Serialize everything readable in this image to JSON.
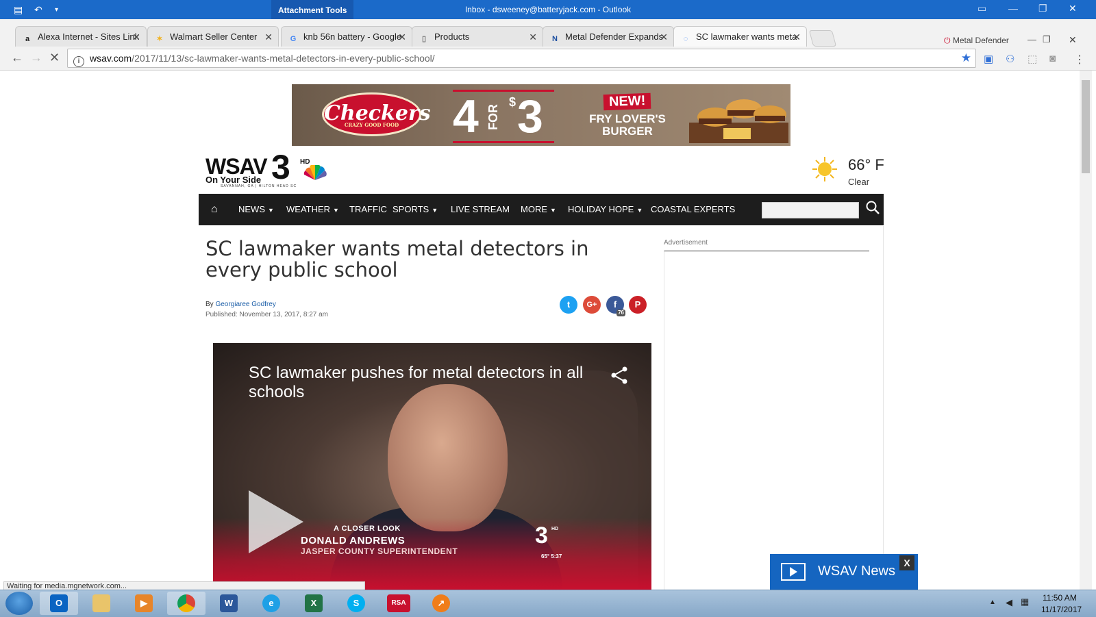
{
  "outlook": {
    "contextual_tab": "Attachment Tools",
    "window_title": "Inbox - dsweeney@batteryjack.com - Outlook"
  },
  "browser": {
    "tabs": [
      {
        "label": "Alexa Internet - Sites Link",
        "icon": "alexa-icon",
        "color": "#222222"
      },
      {
        "label": "Walmart Seller Center",
        "icon": "walmart-spark-icon",
        "color": "#f2b21e"
      },
      {
        "label": "knb 56n battery - Google",
        "icon": "google-icon",
        "color": "#4285f4"
      },
      {
        "label": "Products",
        "icon": "page-icon",
        "color": "#777777"
      },
      {
        "label": "Metal Defender Expands",
        "icon": "n-icon",
        "color": "#1d4fa0"
      },
      {
        "label": "SC lawmaker wants meta",
        "icon": "loading-icon",
        "color": "#4285f4"
      }
    ],
    "extension_badge": "Metal Defender",
    "url_host": "wsav.com",
    "url_path": "/2017/11/13/sc-lawmaker-wants-metal-detectors-in-every-public-school/",
    "status_text": "Waiting for media.mgnetwork.com..."
  },
  "ad": {
    "brand": "Checkers",
    "brand_tagline": "CRAZY GOOD FOOD",
    "deal_main": "4",
    "deal_for": "FOR",
    "deal_price_symbol": "$",
    "deal_price": "3",
    "new_badge": "NEW!",
    "product": "FRY LOVER'S BURGER"
  },
  "site": {
    "logo_text": "WSAV",
    "logo_number": "3",
    "logo_hd": "HD",
    "tagline": "On Your Side",
    "sub_tagline": "SAVANNAH, GA | HILTON HEAD SC",
    "temperature": "66° F",
    "condition": "Clear",
    "nav": [
      {
        "label": "NEWS",
        "caret": true
      },
      {
        "label": "WEATHER",
        "caret": true
      },
      {
        "label": "TRAFFIC",
        "caret": false
      },
      {
        "label": "SPORTS",
        "caret": true
      },
      {
        "label": "LIVE STREAM",
        "caret": false
      },
      {
        "label": "MORE",
        "caret": true
      },
      {
        "label": "HOLIDAY HOPE",
        "caret": true
      },
      {
        "label": "COASTAL EXPERTS",
        "caret": false
      }
    ]
  },
  "article": {
    "headline": "SC lawmaker wants metal detectors in every public school",
    "by": "By",
    "author": "Georgiaree Godfrey",
    "published": "Published: November 13, 2017, 8:27 am",
    "facebook_count": "76",
    "advertisement_label": "Advertisement"
  },
  "video": {
    "title": "SC lawmaker pushes for metal detectors in all schools",
    "segment": "A CLOSER LOOK",
    "name": "DONALD ANDREWS",
    "role": "JASPER COUNTY SUPERINTENDENT",
    "bug_temp_time": "65° 5:37"
  },
  "floating_player": {
    "label": "WSAV News",
    "close": "X"
  },
  "taskbar": {
    "apps": [
      "outlook-icon",
      "file-explorer-icon",
      "media-player-icon",
      "chrome-icon",
      "word-icon",
      "internet-explorer-icon",
      "excel-icon",
      "skype-icon",
      "rsa-icon",
      "chart-app-icon"
    ],
    "rsa_label": "RSA",
    "time": "11:50 AM",
    "date": "11/17/2017"
  }
}
